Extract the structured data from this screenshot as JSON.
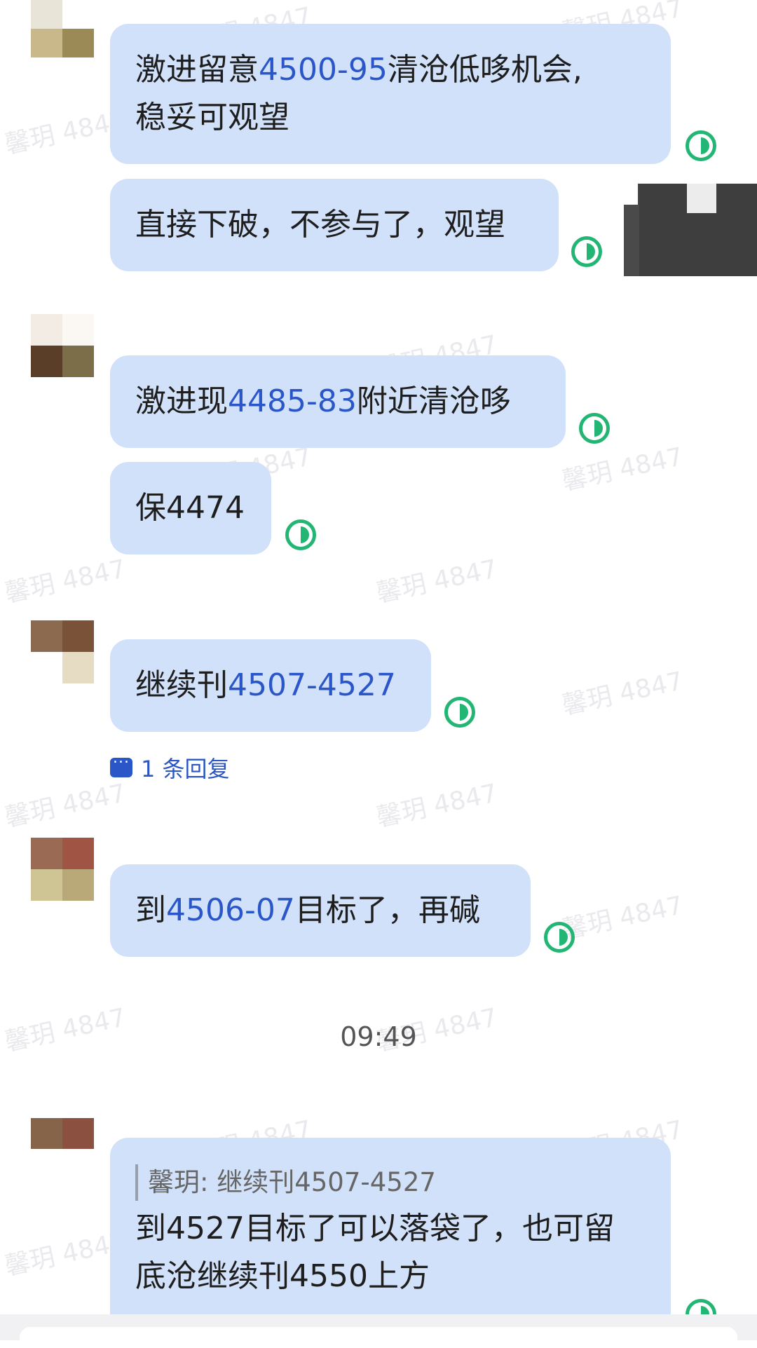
{
  "watermark_text": "馨玥 4847",
  "messages": [
    {
      "line1_a": "激进留意",
      "line1_num": "4500-95",
      "line1_b": "清沧低哆机会,",
      "line2": "稳妥可观望"
    },
    {
      "text": "直接下破，不参与了，观望"
    },
    {
      "a": "激进现",
      "num": "4485-83",
      "b": "附近清沧哆"
    },
    {
      "text": "保4474"
    },
    {
      "a": "继续刊",
      "num": "4507-4527"
    },
    {
      "a": "到",
      "num": "4506-07",
      "b": "目标了，再碱"
    }
  ],
  "reply_link": "1 条回复",
  "timestamp": "09:49",
  "quoted_message": {
    "quote": "馨玥: 继续刊4507-4527",
    "line1": "到4527目标了可以落袋了，也可留",
    "line2": "底沧继续刊4550上方"
  },
  "colors": {
    "bubble": "#d2e1fa",
    "number_link": "#2a56c8",
    "read_receipt": "#22b573"
  }
}
